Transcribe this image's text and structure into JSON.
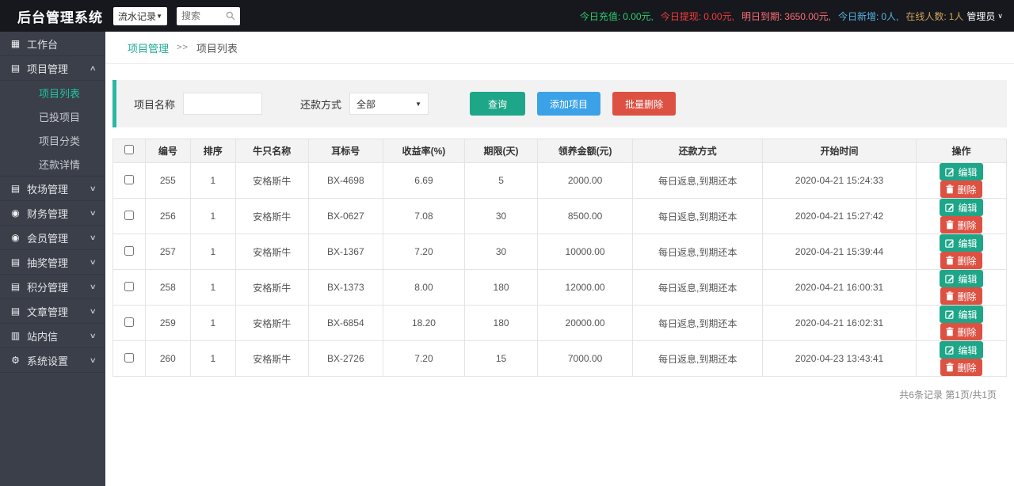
{
  "header": {
    "logo": "后台管理系统",
    "nav_select_value": "流水记录",
    "search_placeholder": "搜索",
    "stats": [
      {
        "label": "今日充值:",
        "value": "0.00元,",
        "color": "#2ecc71"
      },
      {
        "label": "今日提现:",
        "value": "0.00元,",
        "color": "#f53d3d"
      },
      {
        "label": "明日到期:",
        "value": "3650.00元,",
        "color": "#ff6d75"
      },
      {
        "label": "今日新增:",
        "value": "0人,",
        "color": "#57b5e3"
      },
      {
        "label": "在线人数:",
        "value": "1人",
        "color": "#cfa25c"
      }
    ],
    "admin_label": "管理员"
  },
  "sidebar": {
    "items": [
      {
        "label": "工作台",
        "icon": "dashboard-grid-icon",
        "chevron": null
      },
      {
        "label": "项目管理",
        "icon": "document-icon",
        "chevron": "up",
        "children": [
          {
            "label": "项目列表",
            "active": true
          },
          {
            "label": "已投项目",
            "active": false
          },
          {
            "label": "项目分类",
            "active": false
          },
          {
            "label": "还款详情",
            "active": false
          }
        ]
      },
      {
        "label": "牧场管理",
        "icon": "document-icon",
        "chevron": "down"
      },
      {
        "label": "财务管理",
        "icon": "coin-icon",
        "chevron": "down"
      },
      {
        "label": "会员管理",
        "icon": "member-icon",
        "chevron": "down"
      },
      {
        "label": "抽奖管理",
        "icon": "document-icon",
        "chevron": "down"
      },
      {
        "label": "积分管理",
        "icon": "document-icon",
        "chevron": "down"
      },
      {
        "label": "文章管理",
        "icon": "document-icon",
        "chevron": "down"
      },
      {
        "label": "站内信",
        "icon": "mail-icon",
        "chevron": "down"
      },
      {
        "label": "系统设置",
        "icon": "gear-icon",
        "chevron": "down"
      }
    ]
  },
  "breadcrumb": {
    "parent": "项目管理",
    "separator": ">>",
    "current": "项目列表"
  },
  "filter": {
    "name_label": "项目名称",
    "name_value": "",
    "repay_label": "还款方式",
    "repay_value": "全部",
    "query_label": "查询",
    "add_label": "添加项目",
    "batch_delete_label": "批量删除"
  },
  "table": {
    "headers": [
      "编号",
      "排序",
      "牛只名称",
      "耳标号",
      "收益率(%)",
      "期限(天)",
      "领养金额(元)",
      "还款方式",
      "开始时间",
      "操作"
    ],
    "rows": [
      [
        "255",
        "1",
        "安格斯牛",
        "BX-4698",
        "6.69",
        "5",
        "2000.00",
        "每日返息,到期还本",
        "2020-04-21 15:24:33"
      ],
      [
        "256",
        "1",
        "安格斯牛",
        "BX-0627",
        "7.08",
        "30",
        "8500.00",
        "每日返息,到期还本",
        "2020-04-21 15:27:42"
      ],
      [
        "257",
        "1",
        "安格斯牛",
        "BX-1367",
        "7.20",
        "30",
        "10000.00",
        "每日返息,到期还本",
        "2020-04-21 15:39:44"
      ],
      [
        "258",
        "1",
        "安格斯牛",
        "BX-1373",
        "8.00",
        "180",
        "12000.00",
        "每日返息,到期还本",
        "2020-04-21 16:00:31"
      ],
      [
        "259",
        "1",
        "安格斯牛",
        "BX-6854",
        "18.20",
        "180",
        "20000.00",
        "每日返息,到期还本",
        "2020-04-21 16:02:31"
      ],
      [
        "260",
        "1",
        "安格斯牛",
        "BX-2726",
        "7.20",
        "15",
        "7000.00",
        "每日返息,到期还本",
        "2020-04-23 13:43:41"
      ]
    ],
    "actions": {
      "edit": "编辑",
      "delete": "删除"
    }
  },
  "pagination": {
    "text": "共6条记录 第1页/共1页"
  },
  "colors": {
    "accent_teal": "#1ea689",
    "stripe_teal": "#2ab7a3",
    "button_blue": "#3ca2e8",
    "button_red": "#dd5143"
  }
}
